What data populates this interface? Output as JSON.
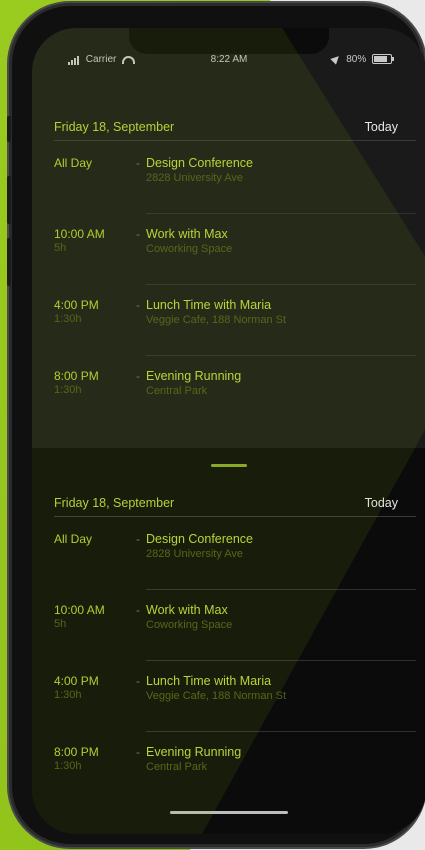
{
  "status": {
    "carrier": "Carrier",
    "time": "8:22 AM",
    "battery": "80%"
  },
  "top_panel": {
    "date": "Friday 18, September",
    "today_label": "Today",
    "events": [
      {
        "time": "All Day",
        "duration": "",
        "title": "Design Conference",
        "location": "2828 University Ave"
      },
      {
        "time": "10:00 AM",
        "duration": "5h",
        "title": "Work with Max",
        "location": "Coworking Space"
      },
      {
        "time": "4:00 PM",
        "duration": "1:30h",
        "title": "Lunch Time with Maria",
        "location": "Veggie Cafe, 188 Norman St"
      },
      {
        "time": "8:00 PM",
        "duration": "1:30h",
        "title": "Evening Running",
        "location": "Central Park"
      }
    ]
  },
  "bottom_panel": {
    "date": "Friday 18, September",
    "today_label": "Today",
    "events": [
      {
        "time": "All Day",
        "duration": "",
        "title": "Design Conference",
        "location": "2828 University Ave"
      },
      {
        "time": "10:00 AM",
        "duration": "5h",
        "title": "Work with Max",
        "location": "Coworking Space"
      },
      {
        "time": "4:00 PM",
        "duration": "1:30h",
        "title": "Lunch Time with Maria",
        "location": "Veggie Cafe, 188 Norman St"
      },
      {
        "time": "8:00 PM",
        "duration": "1:30h",
        "title": "Evening Running",
        "location": "Central Park"
      }
    ]
  },
  "colors": {
    "accent": "#b8d33a",
    "background_green": "#9acb1f",
    "screen": "#0b0b0b"
  },
  "icons": [
    "signal-icon",
    "wifi-icon",
    "location-arrow-icon",
    "battery-icon"
  ]
}
